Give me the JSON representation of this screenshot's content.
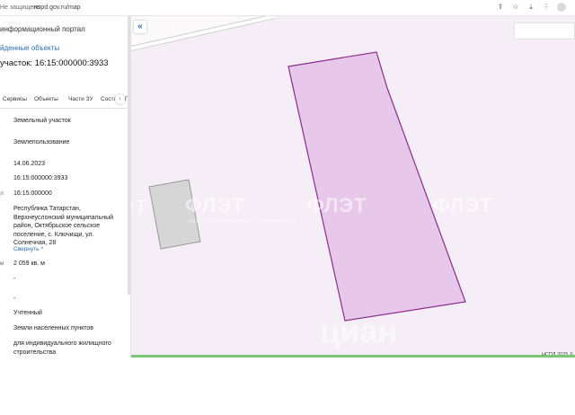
{
  "browser": {
    "security_label": "Не защищено",
    "url": "nspd.gov.ru/map",
    "icons": [
      "share-icon",
      "bookmark-icon",
      "download-icon",
      "extensions-icon",
      "profile-icon"
    ]
  },
  "panel": {
    "portal_title": "информационный портал",
    "found_objects": "йденные объекты",
    "parcel_title": "участок: 16:15:000000:3933",
    "tabs": [
      "Сервисы",
      "Объекты",
      "Части ЗУ",
      "Состав",
      "Г"
    ],
    "rows": [
      {
        "label": "",
        "value": "Земельный участок"
      },
      {
        "label": "",
        "value": "Землепользование"
      },
      {
        "label": "",
        "value": "14.06.2023"
      },
      {
        "label": "",
        "value": "16:15:000000:3933"
      },
      {
        "label": "л",
        "value": "16:15:000000"
      },
      {
        "label": "",
        "value": "Республика Татарстан, Верхнеуслонский муниципальный район, Октябрьское сельское поселение, с. Ключищи, ул. Солнечная, 28"
      },
      {
        "label": "м",
        "value": "2 059 кв. м"
      },
      {
        "label": "",
        "value": "-"
      },
      {
        "label": "",
        "value": "-"
      },
      {
        "label": "",
        "value": "Учтенный"
      },
      {
        "label": "",
        "value": "Земли населенных пунктов"
      },
      {
        "label": "",
        "value": "для индивидуального жилищного строительства"
      }
    ],
    "collapse_label": "Свернуть"
  },
  "map": {
    "collapse_symbol": "«",
    "watermarks": [
      "ФЛЭТ",
      "ФЛЭТ",
      "ФЛЭТ",
      "ФЛЭТ"
    ],
    "watermark_sub": "ИНФОРМАЦИОННЫЙ ПОРТАЛ НЕДВИЖИМОСТИ",
    "cian_watermark": "циан",
    "attribution": "НСПД 2025 ©",
    "colors": {
      "parcel_fill": "#e8c8ea",
      "parcel_stroke": "#8a2c8c",
      "building_fill": "#d6d6d6",
      "building_stroke": "#9a9a9a",
      "area_tint": "#f5eef6"
    }
  }
}
